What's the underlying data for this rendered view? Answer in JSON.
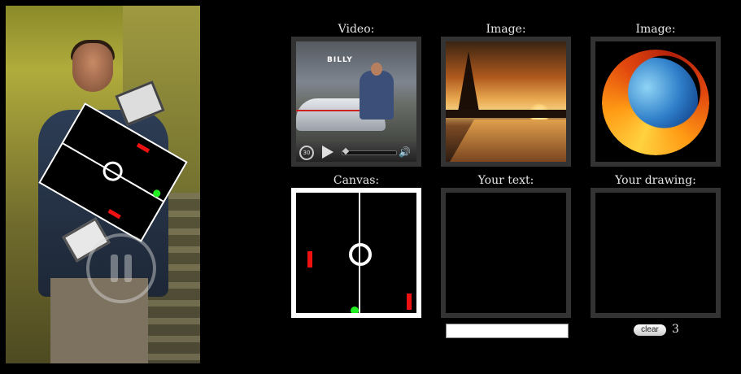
{
  "grid": {
    "video_label": "Video:",
    "image1_label": "Image:",
    "image2_label": "Image:",
    "canvas_label": "Canvas:",
    "text_label": "Your text:",
    "drawing_label": "Your drawing:"
  },
  "video_thumb": {
    "caption": "BILLY",
    "skip_label": "30",
    "volume_glyph": "🔊"
  },
  "controls": {
    "text_value": "",
    "text_placeholder": "",
    "clear_label": "clear",
    "stroke_count": "3"
  },
  "icons": {
    "pause": "pause-icon",
    "play": "play-icon",
    "replay30": "replay-30-icon",
    "volume": "volume-icon"
  },
  "colors": {
    "paddle": "#e11111",
    "ball": "#22ee22",
    "frame_border": "#333333",
    "canvas_border": "#ffffff"
  }
}
